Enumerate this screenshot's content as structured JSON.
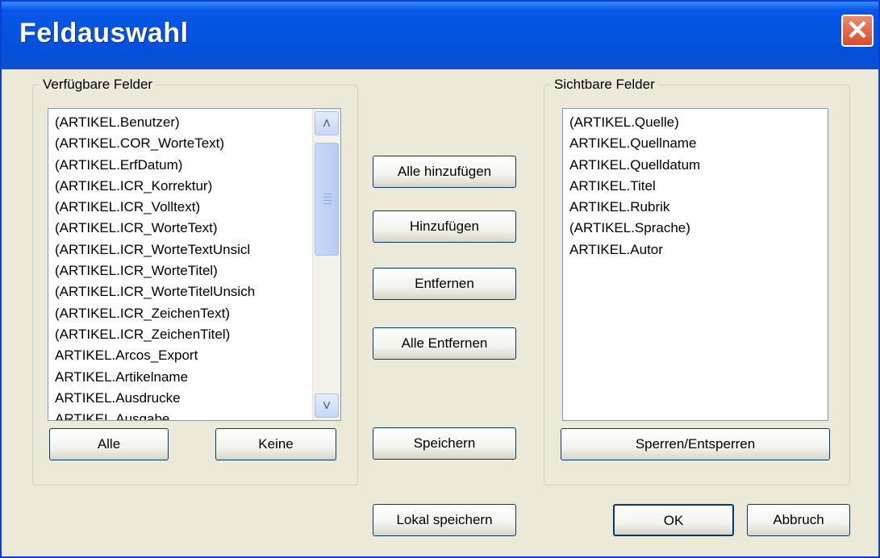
{
  "window": {
    "title": "Feldauswahl"
  },
  "available": {
    "legend": "Verfügbare Felder",
    "items": [
      "(ARTIKEL.Benutzer)",
      "(ARTIKEL.COR_WorteText)",
      "(ARTIKEL.ErfDatum)",
      "(ARTIKEL.ICR_Korrektur)",
      "(ARTIKEL.ICR_Volltext)",
      "(ARTIKEL.ICR_WorteText)",
      "(ARTIKEL.ICR_WorteTextUnsicl",
      "(ARTIKEL.ICR_WorteTitel)",
      "(ARTIKEL.ICR_WorteTitelUnsich",
      "(ARTIKEL.ICR_ZeichenText)",
      "(ARTIKEL.ICR_ZeichenTitel)",
      "ARTIKEL.Arcos_Export",
      "ARTIKEL.Artikelname",
      "ARTIKEL.Ausdrucke",
      "ARTIKEL.Ausgabe"
    ],
    "all_button": "Alle",
    "none_button": "Keine"
  },
  "visible": {
    "legend": "Sichtbare Felder",
    "items": [
      "(ARTIKEL.Quelle)",
      "ARTIKEL.Quellname",
      "ARTIKEL.Quelldatum",
      "ARTIKEL.Titel",
      "ARTIKEL.Rubrik",
      "(ARTIKEL.Sprache)",
      "ARTIKEL.Autor"
    ],
    "lock_button": "Sperren/Entsperren"
  },
  "actions": {
    "add_all": "Alle hinzufügen",
    "add": "Hinzufügen",
    "remove": "Entfernen",
    "remove_all": "Alle Entfernen",
    "save": "Speichern",
    "save_local": "Lokal speichern"
  },
  "footer": {
    "ok": "OK",
    "cancel": "Abbruch"
  },
  "colors": {
    "titlebar": "#0454e0",
    "dialog_bg": "#ece9d8",
    "button_border": "#003c74"
  }
}
